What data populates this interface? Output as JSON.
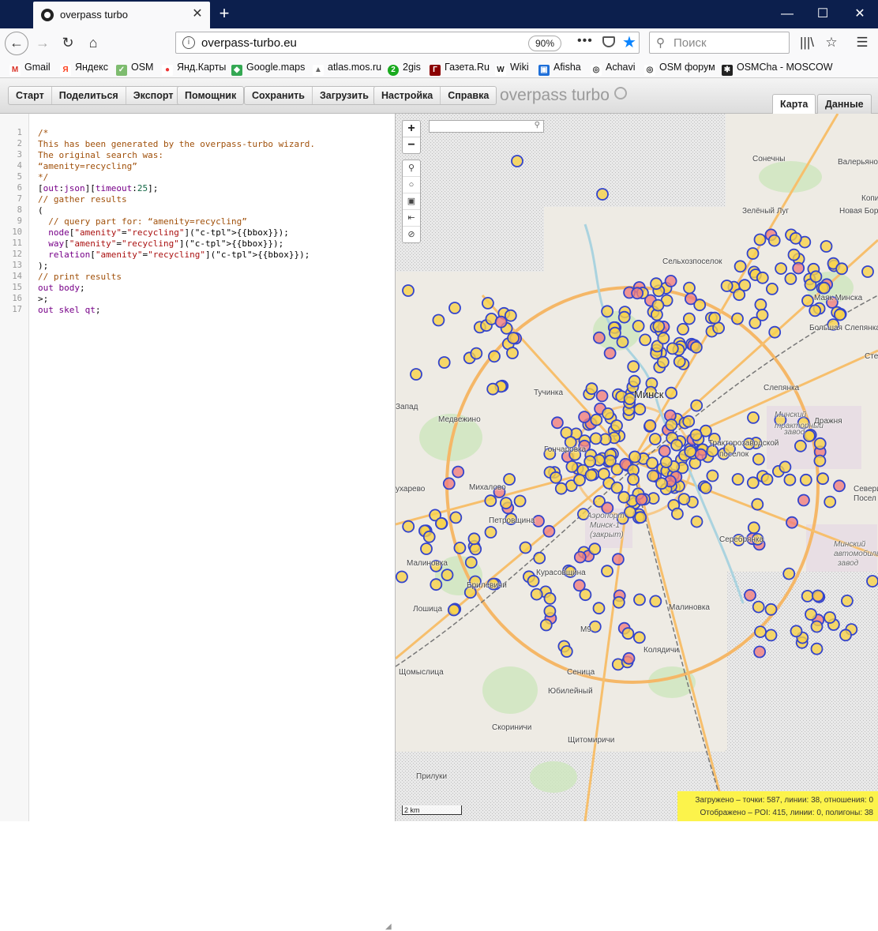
{
  "browser": {
    "tab_title": "overpass turbo",
    "url": "overpass-turbo.eu",
    "zoom": "90%",
    "search_placeholder": "Поиск",
    "bookmarks": [
      {
        "label": "Gmail",
        "icon": "gmail-icon",
        "color": "#d93025",
        "glyph": "M"
      },
      {
        "label": "Яндекс",
        "icon": "yandex-icon",
        "color": "#fc3f1d",
        "glyph": "Я"
      },
      {
        "label": "OSM",
        "icon": "osm-icon",
        "color": "#7ebc6f",
        "glyph": "✓"
      },
      {
        "label": "Янд.Карты",
        "icon": "yandex-maps-icon",
        "color": "#f33",
        "glyph": "●"
      },
      {
        "label": "Google.maps",
        "icon": "google-maps-icon",
        "color": "#34a853",
        "glyph": "◆"
      },
      {
        "label": "atlas.mos.ru",
        "icon": "atlas-icon",
        "color": "#666",
        "glyph": "▲"
      },
      {
        "label": "2gis",
        "icon": "2gis-icon",
        "color": "#19aa1e",
        "glyph": "2"
      },
      {
        "label": "Газета.Ru",
        "icon": "gazeta-icon",
        "color": "#8b0000",
        "glyph": "Г"
      },
      {
        "label": "Wiki",
        "icon": "wiki-icon",
        "color": "#fff",
        "glyph": "W"
      },
      {
        "label": "Afisha",
        "icon": "afisha-icon",
        "color": "#1e6fd9",
        "glyph": "▣"
      },
      {
        "label": "Achavi",
        "icon": "globe-icon",
        "color": "#fff",
        "glyph": "◎"
      },
      {
        "label": "OSM форум",
        "icon": "globe-icon",
        "color": "#fff",
        "glyph": "◎"
      },
      {
        "label": "OSMCha - MOSCOW",
        "icon": "osmcha-icon",
        "color": "#222",
        "glyph": "✱"
      }
    ]
  },
  "toolbar": {
    "group1": [
      "Старт",
      "Поделиться",
      "Экспорт"
    ],
    "group2": [
      "Помощник"
    ],
    "group3": [
      "Сохранить",
      "Загрузить"
    ],
    "group4": [
      "Настройка",
      "Справка"
    ],
    "brand": "overpass turbo",
    "view_tabs": {
      "map": "Карта",
      "data": "Данные"
    }
  },
  "editor": {
    "lines": [
      "/*",
      "This has been generated by the overpass-turbo wizard.",
      "The original search was:",
      "“amenity=recycling”",
      "*/",
      "[out:json][timeout:25];",
      "// gather results",
      "(",
      "  // query part for: “amenity=recycling”",
      "  node[\"amenity\"=\"recycling\"]({{bbox}});",
      "  way[\"amenity\"=\"recycling\"]({{bbox}});",
      "  relation[\"amenity\"=\"recycling\"]({{bbox}});",
      ");",
      "// print results",
      "out body;",
      ">;",
      "out skel qt;"
    ]
  },
  "map": {
    "zoom_in": "+",
    "zoom_out": "−",
    "scale": "2 km",
    "labels": [
      "Сонечны",
      "Валерьяново",
      "Копи",
      "Новая Боро",
      "Зелёный Луг",
      "Сельхозпоселок",
      "Маяк Минска",
      "Большая Слепянка",
      "Сте",
      "Тучинка",
      "Минск",
      "Слепянка",
      "Запад",
      "Медвежино",
      "Минский",
      "тракторный",
      "завод",
      "Дражня",
      "Тракторозаводской",
      "поселок",
      "Гончаровка",
      "Севери",
      "Посел",
      "ухарево",
      "Михалово",
      "Петровщина",
      "Аэропорт",
      "Минск-1",
      "(закрыт)",
      "Серебрянка",
      "Минский",
      "автомобильный",
      "завод",
      "Малиновка",
      "Курасовщина",
      "Брилевичи",
      "Малиновка",
      "Лошица",
      "М9",
      "Колядичи",
      "Щомыслица",
      "Сеница",
      "Юбилейный",
      "Скориничи",
      "Щитомиричи",
      "Прилуки"
    ],
    "stats": {
      "loaded": "Загружено – точки: 587, линии: 38, отношения: 0",
      "shown": "Отображено – POI: 415, линии: 0, полигоны: 38"
    },
    "colors": {
      "marker_stroke": "#3344cc",
      "marker_yellow": "#f7d24a",
      "marker_red": "#f08080",
      "stats_bg": "#fcf34b"
    }
  }
}
